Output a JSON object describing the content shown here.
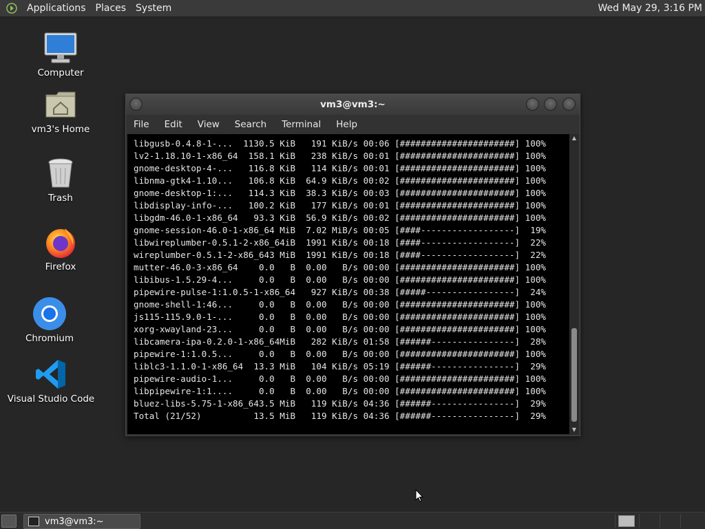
{
  "top_panel": {
    "menus": [
      "Applications",
      "Places",
      "System"
    ],
    "clock": "Wed May 29,  3:16 PM"
  },
  "desktop": {
    "icons": [
      {
        "label": "Computer",
        "icon": "computer-icon"
      },
      {
        "label": "vm3's Home",
        "icon": "home-folder-icon"
      },
      {
        "label": "Trash",
        "icon": "trash-icon"
      },
      {
        "label": "Firefox",
        "icon": "firefox-icon"
      },
      {
        "label": "Chromium",
        "icon": "chromium-icon"
      },
      {
        "label": "Visual Studio Code",
        "icon": "vscode-icon"
      }
    ]
  },
  "terminal": {
    "title": "vm3@vm3:~",
    "menus": [
      "File",
      "Edit",
      "View",
      "Search",
      "Terminal",
      "Help"
    ],
    "lines": [
      "libgusb-0.4.8-1-...  1130.5 KiB   191 KiB/s 00:06 [######################] 100%",
      "lv2-1.18.10-1-x86_64  158.1 KiB   238 KiB/s 00:01 [######################] 100%",
      "gnome-desktop-4-...   116.8 KiB   114 KiB/s 00:01 [######################] 100%",
      "libnma-gtk4-1.10...   106.8 KiB  64.9 KiB/s 00:02 [######################] 100%",
      "gnome-desktop-1:...   114.3 KiB  38.3 KiB/s 00:03 [######################] 100%",
      "libdisplay-info-...   100.2 KiB   177 KiB/s 00:01 [######################] 100%",
      "libgdm-46.0-1-x86_64   93.3 KiB  56.9 KiB/s 00:02 [######################] 100%",
      "gnome-session-46.0-1-x86_64 MiB  7.02 MiB/s 00:05 [####------------------]  19%",
      "libwireplumber-0.5.1-2-x86_64iB  1991 KiB/s 00:18 [####------------------]  22%",
      "wireplumber-0.5.1-2-x86_643 MiB  1991 KiB/s 00:18 [####------------------]  22%",
      "mutter-46.0-3-x86_64    0.0   B  0.00   B/s 00:00 [######################] 100%",
      "libibus-1.5.29-4...     0.0   B  0.00   B/s 00:00 [######################] 100%",
      "pipewire-pulse-1:1.0.5-1-x86_64   927 KiB/s 00:38 [#####-----------------]  24%",
      "gnome-shell-1:46...     0.0   B  0.00   B/s 00:00 [######################] 100%",
      "js115-115.9.0-1-...     0.0   B  0.00   B/s 00:00 [######################] 100%",
      "xorg-xwayland-23...     0.0   B  0.00   B/s 00:00 [######################] 100%",
      "libcamera-ipa-0.2.0-1-x86_64MiB   282 KiB/s 01:58 [######----------------]  28%",
      "pipewire-1:1.0.5...     0.0   B  0.00   B/s 00:00 [######################] 100%",
      "liblc3-1.1.0-1-x86_64  13.3 MiB   104 KiB/s 05:19 [######----------------]  29%",
      "pipewire-audio-1...     0.0   B  0.00   B/s 00:00 [######################] 100%",
      "libpipewire-1:1....     0.0   B  0.00   B/s 00:00 [######################] 100%",
      "bluez-libs-5.75-1-x86_643.5 MiB   119 KiB/s 04:36 [######----------------]  29%",
      "Total (21/52)          13.5 MiB   119 KiB/s 04:36 [######----------------]  29%"
    ]
  },
  "taskbar": {
    "task_label": "vm3@vm3:~"
  },
  "colors": {
    "desktop_bg": "#262626",
    "panel_bg": "#3a3a3a",
    "terminal_bg": "#000000",
    "terminal_fg": "#e6e6e6"
  }
}
